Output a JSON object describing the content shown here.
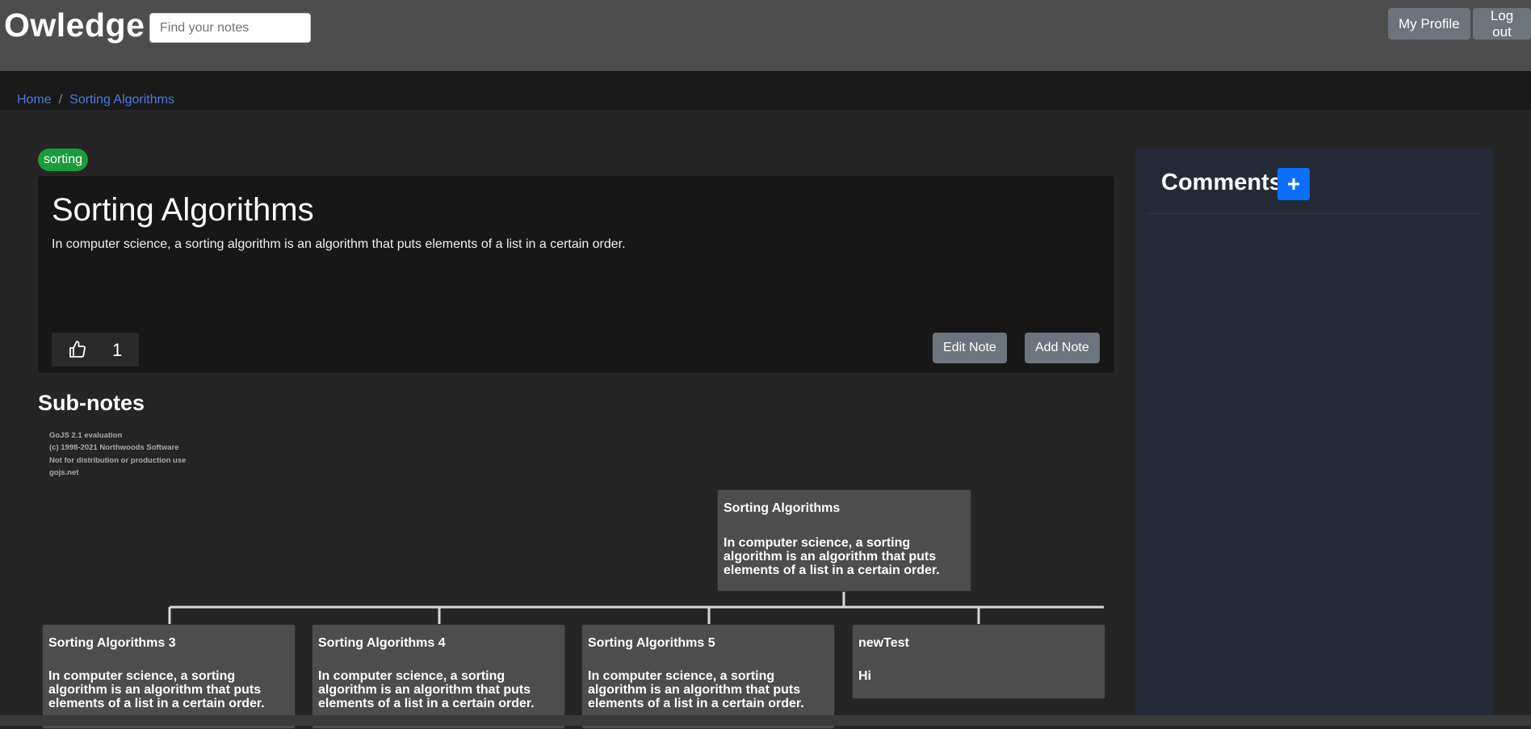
{
  "navbar": {
    "brand": "Owledge",
    "search_placeholder": "Find your notes",
    "profile_label": "My Profile",
    "logout_label": "Log out"
  },
  "breadcrumb": {
    "home": "Home",
    "current": "Sorting Algorithms"
  },
  "note": {
    "tag": "sorting",
    "title": "Sorting Algorithms",
    "body": "In computer science, a sorting algorithm is an algorithm that puts elements of a list in a certain order.",
    "likes": "1",
    "edit_label": "Edit Note",
    "add_label": "Add Note"
  },
  "subnotes": {
    "title": "Sub-notes",
    "watermark": [
      "GoJS 2.1 evaluation",
      "(c) 1998-2021 Northwoods Software",
      "Not for distribution or production use",
      "gojs.net"
    ],
    "root": {
      "title": "Sorting Algorithms",
      "body": "In computer science, a sorting algorithm is an algorithm that puts elements of a list in a certain order."
    },
    "children": [
      {
        "title": "Sorting Algorithms 3",
        "body": "In computer science, a sorting algorithm is an algorithm that puts elements of a list in a certain order."
      },
      {
        "title": "Sorting Algorithms 4",
        "body": "In computer science, a sorting algorithm is an algorithm that puts elements of a list in a certain order."
      },
      {
        "title": "Sorting Algorithms 5",
        "body": "In computer science, a sorting algorithm is an algorithm that puts elements of a list in a certain order."
      },
      {
        "title": "newTest",
        "body": "Hi"
      }
    ]
  },
  "comments": {
    "title": "Comments",
    "add_symbol": "+"
  },
  "colors": {
    "navbar": "#4d4d4d",
    "tag": "#1a9b3c",
    "link": "#4a7cdb",
    "primary_button": "#0d6efd",
    "secondary_button": "#6c757d"
  }
}
